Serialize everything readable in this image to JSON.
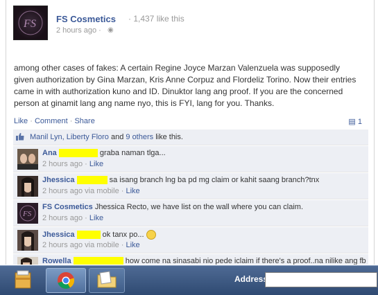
{
  "post": {
    "page_name": "FS Cosmetics",
    "likes": "· 1,437 like this",
    "time": "2 hours ago ·",
    "text": "among other cases of fakes: A certain Regine Joyce Marzan Valenzuela was supposedly given authorization by Gina Marzan, Kris Anne Corpuz and Flordeliz Torino. Now their entries came in with authorization kuno and ID. Dinuktor lang ang proof. If you are the concerned person at ginamit lang ang name nyo, this is FYI, lang for you. Thanks."
  },
  "actions": {
    "like": "Like",
    "comment": "Comment",
    "share": "Share",
    "separator": "·",
    "comment_count": "1"
  },
  "likes_row": {
    "names": "Manil Lyn, Liberty Floro",
    "and": " and ",
    "others": "9 others",
    "suffix": " like this."
  },
  "comments": [
    {
      "name": "Ana",
      "text": "graba naman tlga...",
      "time": "2 hours ago ·",
      "via": "",
      "like": "Like"
    },
    {
      "name": "Jhessica",
      "text": "sa isang branch lng ba pd mg claim or kahit saang branch?tnx",
      "time": "2 hours ago",
      "via": " via mobile ·",
      "like": "Like"
    },
    {
      "name": "FS Cosmetics",
      "text": "Jhessica Recto, we have list on the wall where you can claim.",
      "time": "2 hours ago ·",
      "via": "",
      "like": "Like"
    },
    {
      "name": "Jhessica",
      "text": "ok tanx po...",
      "time": "2 hours ago",
      "via": " via mobile ·",
      "like": "Like"
    },
    {
      "name": "Rowella",
      "text": "how come na sinasabi nio pede iclaim if there's a proof..na nilike ang fb",
      "time": "",
      "via": "",
      "like": ""
    }
  ],
  "taskbar": {
    "address_label": "Address",
    "address_value": ""
  },
  "colors": {
    "link": "#3b5998",
    "highlight": "#ffff00",
    "comment_bg": "#edeff4",
    "taskbar": "#2f4a72"
  }
}
